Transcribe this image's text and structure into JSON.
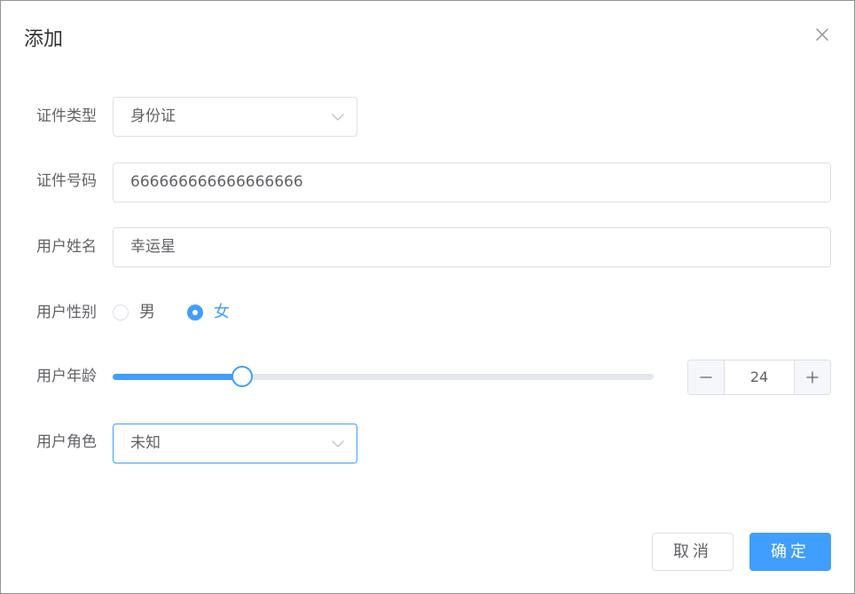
{
  "dialog": {
    "title": "添加"
  },
  "form": {
    "id_type": {
      "label": "证件类型",
      "value": "身份证"
    },
    "id_number": {
      "label": "证件号码",
      "value": "666666666666666666"
    },
    "user_name": {
      "label": "用户姓名",
      "value": "幸运星"
    },
    "gender": {
      "label": "用户性别",
      "options": [
        {
          "label": "男",
          "checked": false
        },
        {
          "label": "女",
          "checked": true
        }
      ]
    },
    "age": {
      "label": "用户年龄",
      "value": "24",
      "min": 0,
      "max": 100
    },
    "role": {
      "label": "用户角色",
      "value": "未知"
    }
  },
  "footer": {
    "cancel_label": "取消",
    "confirm_label": "确定"
  },
  "colors": {
    "primary": "#409eff",
    "border": "#dcdfe6",
    "text": "#606266",
    "title": "#303133"
  },
  "icons": {
    "close": "close-icon",
    "select_arrow": "chevron-down-icon",
    "minus": "minus-icon",
    "plus": "plus-icon"
  }
}
